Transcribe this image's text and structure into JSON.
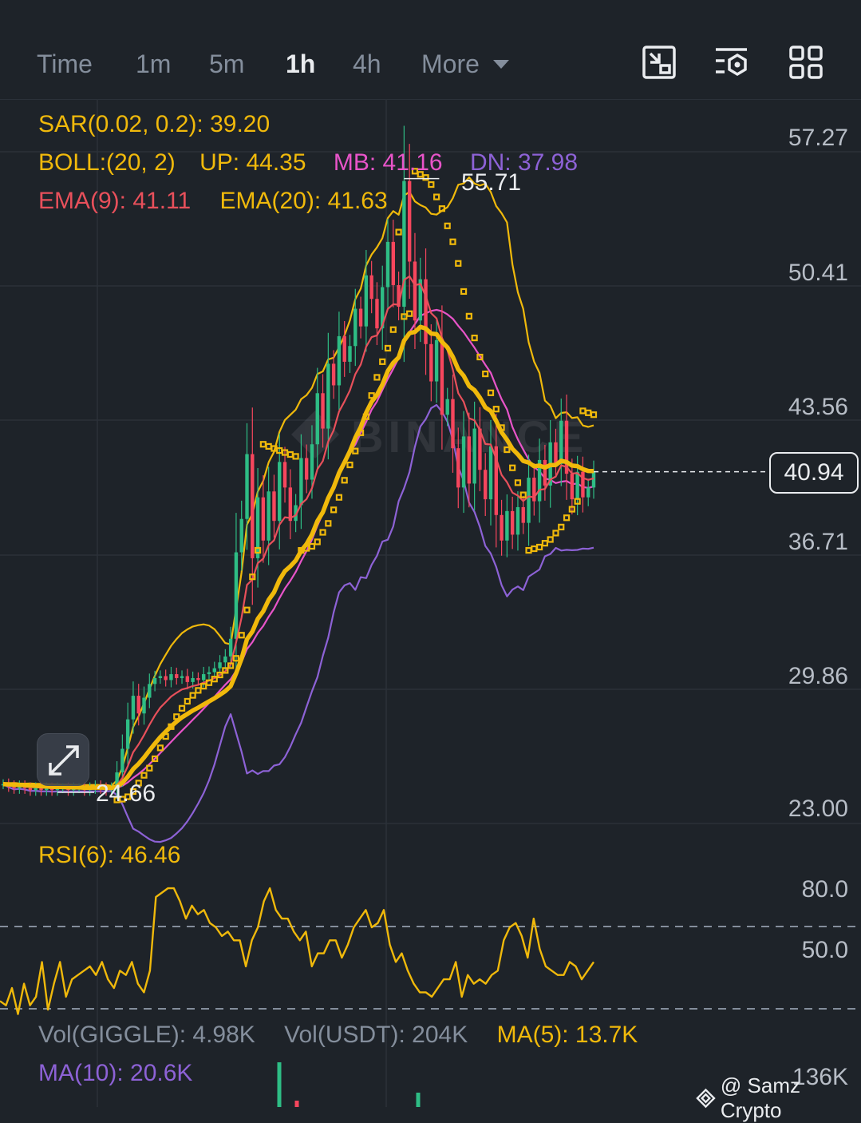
{
  "toolbar": {
    "timeframes": [
      {
        "label": "Time",
        "active": false
      },
      {
        "label": "1m",
        "active": false
      },
      {
        "label": "5m",
        "active": false
      },
      {
        "label": "1h",
        "active": true
      },
      {
        "label": "4h",
        "active": false
      },
      {
        "label": "More",
        "active": false
      }
    ],
    "icons": [
      "chart-toggle-icon",
      "indicator-settings-icon",
      "grid-layout-icon"
    ]
  },
  "main_legend": {
    "sar": "SAR(0.02, 0.2): 39.20",
    "boll": "BOLL:(20, 2)",
    "boll_up": "UP: 44.35",
    "boll_mb": "MB: 41.16",
    "boll_dn": "DN: 37.98",
    "ema9": "EMA(9): 41.11",
    "ema20": "EMA(20): 41.63"
  },
  "price_axis": [
    "57.27",
    "50.41",
    "43.56",
    "36.71",
    "29.86",
    "23.00"
  ],
  "markers": {
    "high": "55.71",
    "low": "24.66",
    "current_price": "40.94"
  },
  "rsi": {
    "legend": "RSI(6): 46.46",
    "axis": [
      "80.0",
      "50.0"
    ],
    "values": [
      28,
      26,
      34,
      22,
      36,
      26,
      30,
      46,
      24,
      36,
      46,
      30,
      38,
      40,
      42,
      44,
      40,
      46,
      38,
      34,
      42,
      40,
      46,
      36,
      32,
      42,
      76,
      78,
      80,
      80,
      74,
      66,
      72,
      68,
      70,
      64,
      62,
      58,
      60,
      56,
      56,
      44,
      56,
      62,
      74,
      80,
      70,
      66,
      66,
      60,
      56,
      60,
      44,
      50,
      50,
      56,
      56,
      48,
      54,
      62,
      66,
      70,
      62,
      64,
      70,
      54,
      46,
      50,
      42,
      36,
      32,
      32,
      30,
      34,
      38,
      38,
      46,
      30,
      40,
      36,
      38,
      36,
      40,
      42,
      56,
      62,
      64,
      58,
      48,
      66,
      52,
      44,
      42,
      40,
      40,
      46,
      44,
      38,
      42,
      46
    ]
  },
  "volume": {
    "vol_base": "Vol(GIGGLE): 4.98K",
    "vol_quote": "Vol(USDT): 204K",
    "ma5": "MA(5): 13.7K",
    "ma10": "MA(10): 20.6K",
    "axis": "136K"
  },
  "watermark": "@ Samz Crypto",
  "colors": {
    "up": "#2ebd85",
    "down": "#f6465d",
    "sar": "#f0b90b",
    "boll_up": "#f0b90b",
    "boll_mb": "#e854c9",
    "boll_dn": "#8d62d6",
    "ema9": "#e8505b",
    "ema20": "#f0b90b",
    "rsi": "#f0b90b"
  },
  "chart_data": {
    "type": "candlestick",
    "pair": "GIGGLE/USDT",
    "interval": "1h",
    "ylim": [
      23.0,
      57.27
    ],
    "closes": [
      25.0,
      24.9,
      24.8,
      24.9,
      24.8,
      24.7,
      24.8,
      24.7,
      24.8,
      24.7,
      24.8,
      24.8,
      24.7,
      24.8,
      24.8,
      24.7,
      24.8,
      24.9,
      24.8,
      24.7,
      24.8,
      25.6,
      26.8,
      28.3,
      29.5,
      28.6,
      29.4,
      30.1,
      30.4,
      30.5,
      30.3,
      30.6,
      30.4,
      30.5,
      30.2,
      30.4,
      30.3,
      30.6,
      30.7,
      30.9,
      31.2,
      31.5,
      32.4,
      36.8,
      38.5,
      41.8,
      36.5,
      39.6,
      37.4,
      39.9,
      38.4,
      41.4,
      40.1,
      38.4,
      39.2,
      41.6,
      40.5,
      42.3,
      44.9,
      43.1,
      46.4,
      45.3,
      47.8,
      46.5,
      47.3,
      49.2,
      48.3,
      50.9,
      49.7,
      48.2,
      50.3,
      52.6,
      50.4,
      49.3,
      55.7,
      51.6,
      48.6,
      50.7,
      47.4,
      45.5,
      47.6,
      43.8,
      44.6,
      42.1,
      40.1,
      42.7,
      40.3,
      43.1,
      41.0,
      39.5,
      42.2,
      38.7,
      37.4,
      38.9,
      37.7,
      39.1,
      38.3,
      40.6,
      39.4,
      41.5,
      40.2,
      42.4,
      41.3,
      43.5,
      40.8,
      39.5,
      40.9,
      39.6,
      40.1,
      40.9
    ]
  }
}
